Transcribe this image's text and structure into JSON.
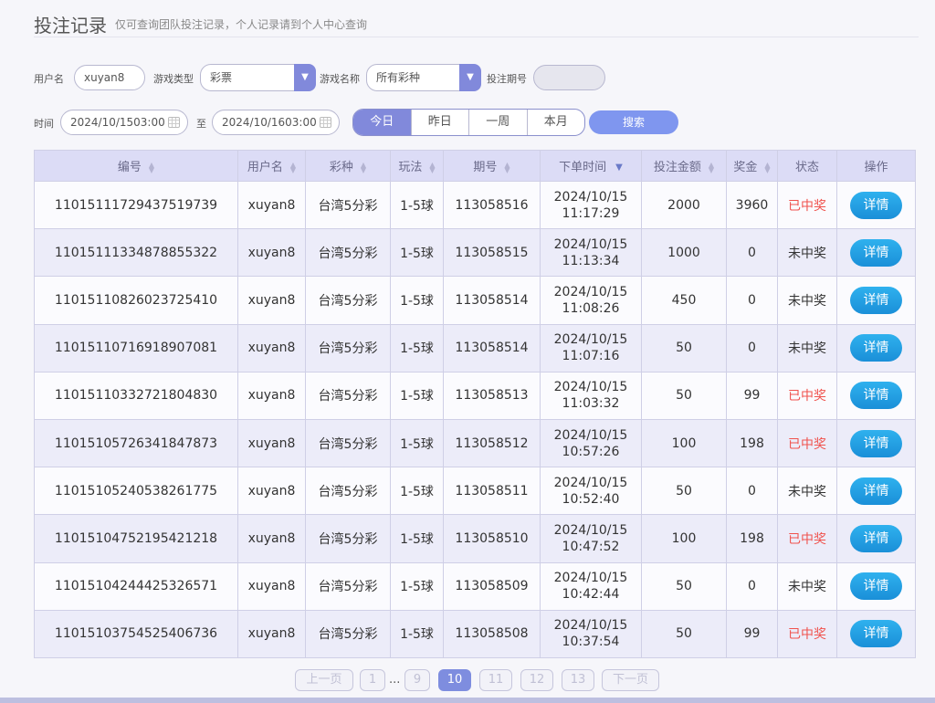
{
  "header": {
    "title": "投注记录",
    "subtitle": "仅可查询团队投注记录，个人记录请到个人中心查询"
  },
  "filters": {
    "username_label": "用户名",
    "username_value": "xuyan8",
    "game_type_label": "游戏类型",
    "game_type_value": "彩票",
    "game_name_label": "游戏名称",
    "game_name_value": "所有彩种",
    "issue_label": "投注期号",
    "issue_value": "",
    "time_label": "时间",
    "start_time": "2024/10/15 03:00",
    "to_label": "至",
    "end_time": "2024/10/16 03:00",
    "range_tabs": [
      "今日",
      "昨日",
      "一周",
      "本月"
    ],
    "active_range": "今日",
    "search_label": "搜索"
  },
  "table": {
    "headers": [
      "编号",
      "用户名",
      "彩种",
      "玩法",
      "期号",
      "下单时间",
      "投注金额",
      "奖金",
      "状态",
      "操作"
    ],
    "detail_label": "详情",
    "rows": [
      {
        "id": "110151117294375197 39",
        "user": "xuyan8",
        "lottery": "台湾5分彩",
        "play": "1-5球",
        "issue": "113058516",
        "date": "2024/10/15",
        "time": "11:17:29",
        "amount": "2000",
        "prize": "3960",
        "status": "已中奖",
        "won": true
      },
      {
        "id": "110151113348788553 22",
        "user": "xuyan8",
        "lottery": "台湾5分彩",
        "play": "1-5球",
        "issue": "113058515",
        "date": "2024/10/15",
        "time": "11:13:34",
        "amount": "1000",
        "prize": "0",
        "status": "未中奖",
        "won": false
      },
      {
        "id": "110151108260237254 10",
        "user": "xuyan8",
        "lottery": "台湾5分彩",
        "play": "1-5球",
        "issue": "113058514",
        "date": "2024/10/15",
        "time": "11:08:26",
        "amount": "450",
        "prize": "0",
        "status": "未中奖",
        "won": false
      },
      {
        "id": "110151107169189070 81",
        "user": "xuyan8",
        "lottery": "台湾5分彩",
        "play": "1-5球",
        "issue": "113058514",
        "date": "2024/10/15",
        "time": "11:07:16",
        "amount": "50",
        "prize": "0",
        "status": "未中奖",
        "won": false
      },
      {
        "id": "110151103327218048 30",
        "user": "xuyan8",
        "lottery": "台湾5分彩",
        "play": "1-5球",
        "issue": "113058513",
        "date": "2024/10/15",
        "time": "11:03:32",
        "amount": "50",
        "prize": "99",
        "status": "已中奖",
        "won": true
      },
      {
        "id": "110151057263418478 73",
        "user": "xuyan8",
        "lottery": "台湾5分彩",
        "play": "1-5球",
        "issue": "113058512",
        "date": "2024/10/15",
        "time": "10:57:26",
        "amount": "100",
        "prize": "198",
        "status": "已中奖",
        "won": true
      },
      {
        "id": "110151052405382617 75",
        "user": "xuyan8",
        "lottery": "台湾5分彩",
        "play": "1-5球",
        "issue": "113058511",
        "date": "2024/10/15",
        "time": "10:52:40",
        "amount": "50",
        "prize": "0",
        "status": "未中奖",
        "won": false
      },
      {
        "id": "110151047521954212 18",
        "user": "xuyan8",
        "lottery": "台湾5分彩",
        "play": "1-5球",
        "issue": "113058510",
        "date": "2024/10/15",
        "time": "10:47:52",
        "amount": "100",
        "prize": "198",
        "status": "已中奖",
        "won": true
      },
      {
        "id": "110151042444253265 71",
        "user": "xuyan8",
        "lottery": "台湾5分彩",
        "play": "1-5球",
        "issue": "113058509",
        "date": "2024/10/15",
        "time": "10:42:44",
        "amount": "50",
        "prize": "0",
        "status": "未中奖",
        "won": false
      },
      {
        "id": "110151037545254067 36",
        "user": "xuyan8",
        "lottery": "台湾5分彩",
        "play": "1-5球",
        "issue": "113058508",
        "date": "2024/10/15",
        "time": "10:37:54",
        "amount": "50",
        "prize": "99",
        "status": "已中奖",
        "won": true
      }
    ]
  },
  "pagination": {
    "prev_label": "上一页",
    "next_label": "下一页",
    "first_page": "1",
    "ellipsis": "...",
    "pages": [
      "9",
      "10",
      "11",
      "12",
      "13"
    ],
    "current_page": "10"
  },
  "colors": {
    "accent": "#8189db",
    "win": "#f0524d",
    "detail_button": "#1a9be0"
  }
}
